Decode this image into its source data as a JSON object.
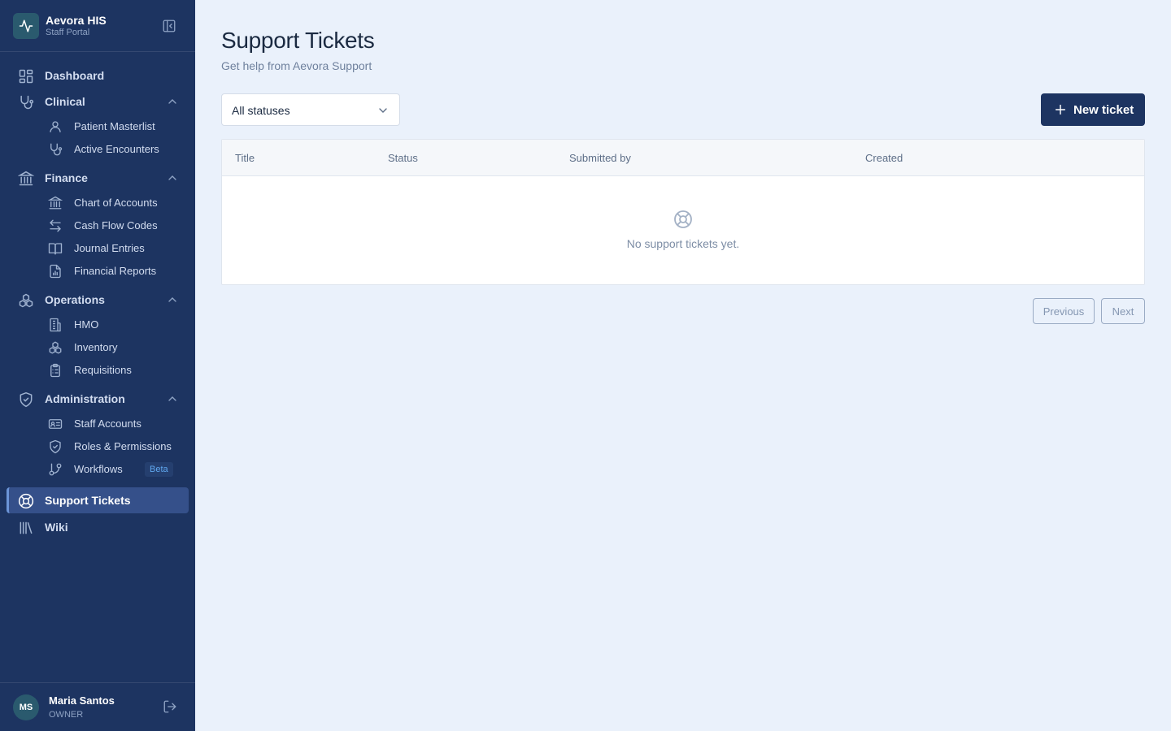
{
  "app": {
    "name": "Aevora HIS",
    "subtitle": "Staff Portal"
  },
  "sidebar": {
    "dashboard": "Dashboard",
    "clinical": {
      "label": "Clinical",
      "items": [
        "Patient Masterlist",
        "Active Encounters"
      ]
    },
    "finance": {
      "label": "Finance",
      "items": [
        "Chart of Accounts",
        "Cash Flow Codes",
        "Journal Entries",
        "Financial Reports"
      ]
    },
    "operations": {
      "label": "Operations",
      "items": [
        "HMO",
        "Inventory",
        "Requisitions"
      ]
    },
    "administration": {
      "label": "Administration",
      "items": [
        "Staff Accounts",
        "Roles & Permissions",
        "Workflows"
      ],
      "beta_badge": "Beta"
    },
    "support_tickets": "Support Tickets",
    "wiki": "Wiki"
  },
  "user": {
    "initials": "MS",
    "name": "Maria Santos",
    "role": "OWNER"
  },
  "page": {
    "title": "Support Tickets",
    "subtitle": "Get help from Aevora Support"
  },
  "filter": {
    "selected": "All statuses"
  },
  "actions": {
    "new_ticket": "New ticket"
  },
  "table": {
    "columns": [
      "Title",
      "Status",
      "Submitted by",
      "Created"
    ],
    "empty_message": "No support tickets yet."
  },
  "pagination": {
    "previous": "Previous",
    "next": "Next"
  },
  "colors": {
    "sidebar_bg": "#1d3461",
    "page_bg": "#eaf1fb",
    "primary": "#1d3461",
    "accent": "#6c95d8"
  }
}
